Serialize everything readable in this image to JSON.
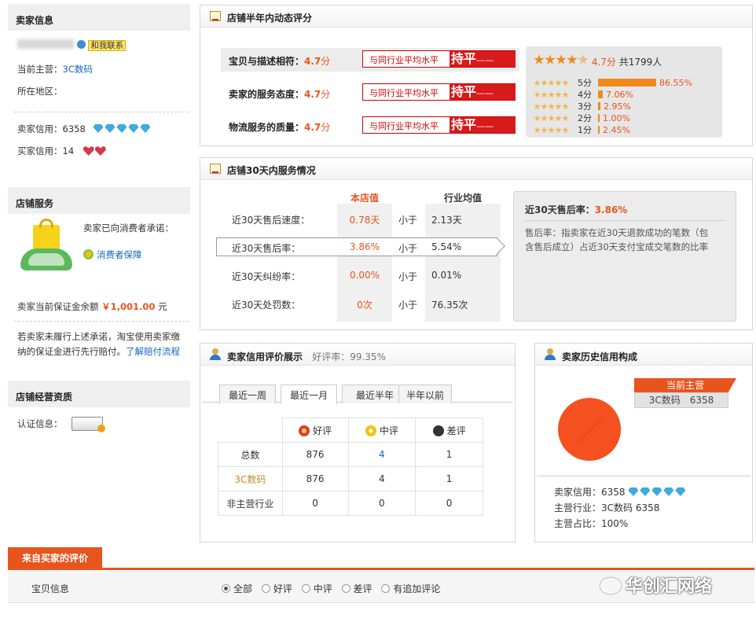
{
  "seller_info": {
    "header": "卖家信息",
    "contact_label": "和我联系",
    "main_business_label": "当前主营：",
    "main_business_value": "3C数码",
    "region_label": "所在地区：",
    "seller_credit_label": "卖家信用：",
    "seller_credit_value": "6358",
    "buyer_credit_label": "买家信用：",
    "buyer_credit_value": "14"
  },
  "store_service": {
    "header": "店铺服务",
    "promise_text": "卖家已向消费者承诺：",
    "guarantee_link": "消费者保障",
    "deposit_label": "卖家当前保证金余额",
    "deposit_value": "￥1,001.00",
    "deposit_unit": "元",
    "note_line1": "若卖家未履行上述承诺，淘宝使用卖家缴",
    "note_line2": "纳的保证金进行先行赔付。",
    "note_link": "了解赔付流程"
  },
  "store_qualification": {
    "header": "店铺经营资质",
    "cert_label": "认证信息："
  },
  "dynamic_rating": {
    "title": "店铺半年内动态评分",
    "rows": [
      {
        "label": "宝贝与描述相符：",
        "score": "4.7",
        "unit": "分",
        "compare": "与同行业平均水平",
        "status": "持平",
        "dash": "——"
      },
      {
        "label": "卖家的服务态度：",
        "score": "4.7",
        "unit": "分",
        "compare": "与同行业平均水平",
        "status": "持平",
        "dash": "——"
      },
      {
        "label": "物流服务的质量：",
        "score": "4.7",
        "unit": "分",
        "compare": "与同行业平均水平",
        "status": "持平",
        "dash": "——"
      }
    ],
    "summary_score": "4.7分",
    "summary_count": "共1799人",
    "distribution": [
      {
        "label": "5分",
        "percent": "86.55%",
        "value": 86.55
      },
      {
        "label": "4分",
        "percent": "7.06%",
        "value": 7.06
      },
      {
        "label": "3分",
        "percent": "2.95%",
        "value": 2.95
      },
      {
        "label": "2分",
        "percent": "1.00%",
        "value": 1.0
      },
      {
        "label": "1分",
        "percent": "2.45%",
        "value": 2.45
      }
    ]
  },
  "service_30d": {
    "title": "店铺30天内服务情况",
    "col_store": "本店值",
    "col_industry": "行业均值",
    "rows": [
      {
        "label": "近30天售后速度：",
        "store": "0.78天",
        "cmp": "小于",
        "industry": "2.13天"
      },
      {
        "label": "近30天售后率：",
        "store": "3.86%",
        "cmp": "小于",
        "industry": "5.54%"
      },
      {
        "label": "近30天纠纷率：",
        "store": "0.00%",
        "cmp": "小于",
        "industry": "0.01%"
      },
      {
        "label": "近30天处罚数：",
        "store": "0次",
        "cmp": "小于",
        "industry": "76.35次"
      }
    ],
    "detail_title": "近30天售后率：",
    "detail_value": "3.86%",
    "detail_desc_line1": "售后率：指卖家在近30天退款成功的笔数（包",
    "detail_desc_line2": "含售后成立）占近30天支付宝成交笔数的比率"
  },
  "credit_display": {
    "title": "卖家信用评价展示",
    "good_rate_label": "好评率：99.35%",
    "tabs": [
      "最近一周",
      "最近一月",
      "最近半年",
      "半年以前"
    ],
    "active_tab": 1,
    "headers": [
      "好评",
      "中评",
      "差评"
    ],
    "rows": [
      {
        "label": "总数",
        "good": "876",
        "mid": "4",
        "bad": "1"
      },
      {
        "label": "3C数码",
        "good": "876",
        "mid": "4",
        "bad": "1"
      },
      {
        "label": "非主营行业",
        "good": "0",
        "mid": "0",
        "bad": "0"
      }
    ]
  },
  "history_credit": {
    "title": "卖家历史信用构成",
    "callout_title": "当前主营",
    "callout_value": "3C数码　6358",
    "pie_color": "#f5501f",
    "seller_credit_label": "卖家信用：6358",
    "main_industry_label": "主营行业：3C数码 6358",
    "main_share_label": "主营占比：100%",
    "share_value": 100
  },
  "buyer_reviews": {
    "tab_label": "来自买家的评价",
    "item_label": "宝贝信息",
    "filters": [
      "全部",
      "好评",
      "中评",
      "差评",
      "有追加评论"
    ],
    "selected_filter": 0
  },
  "watermark": "华创汇网络",
  "colors": {
    "accent": "#e8541e",
    "badge_red": "#d71a1a",
    "tab_orange": "#e8541e"
  }
}
